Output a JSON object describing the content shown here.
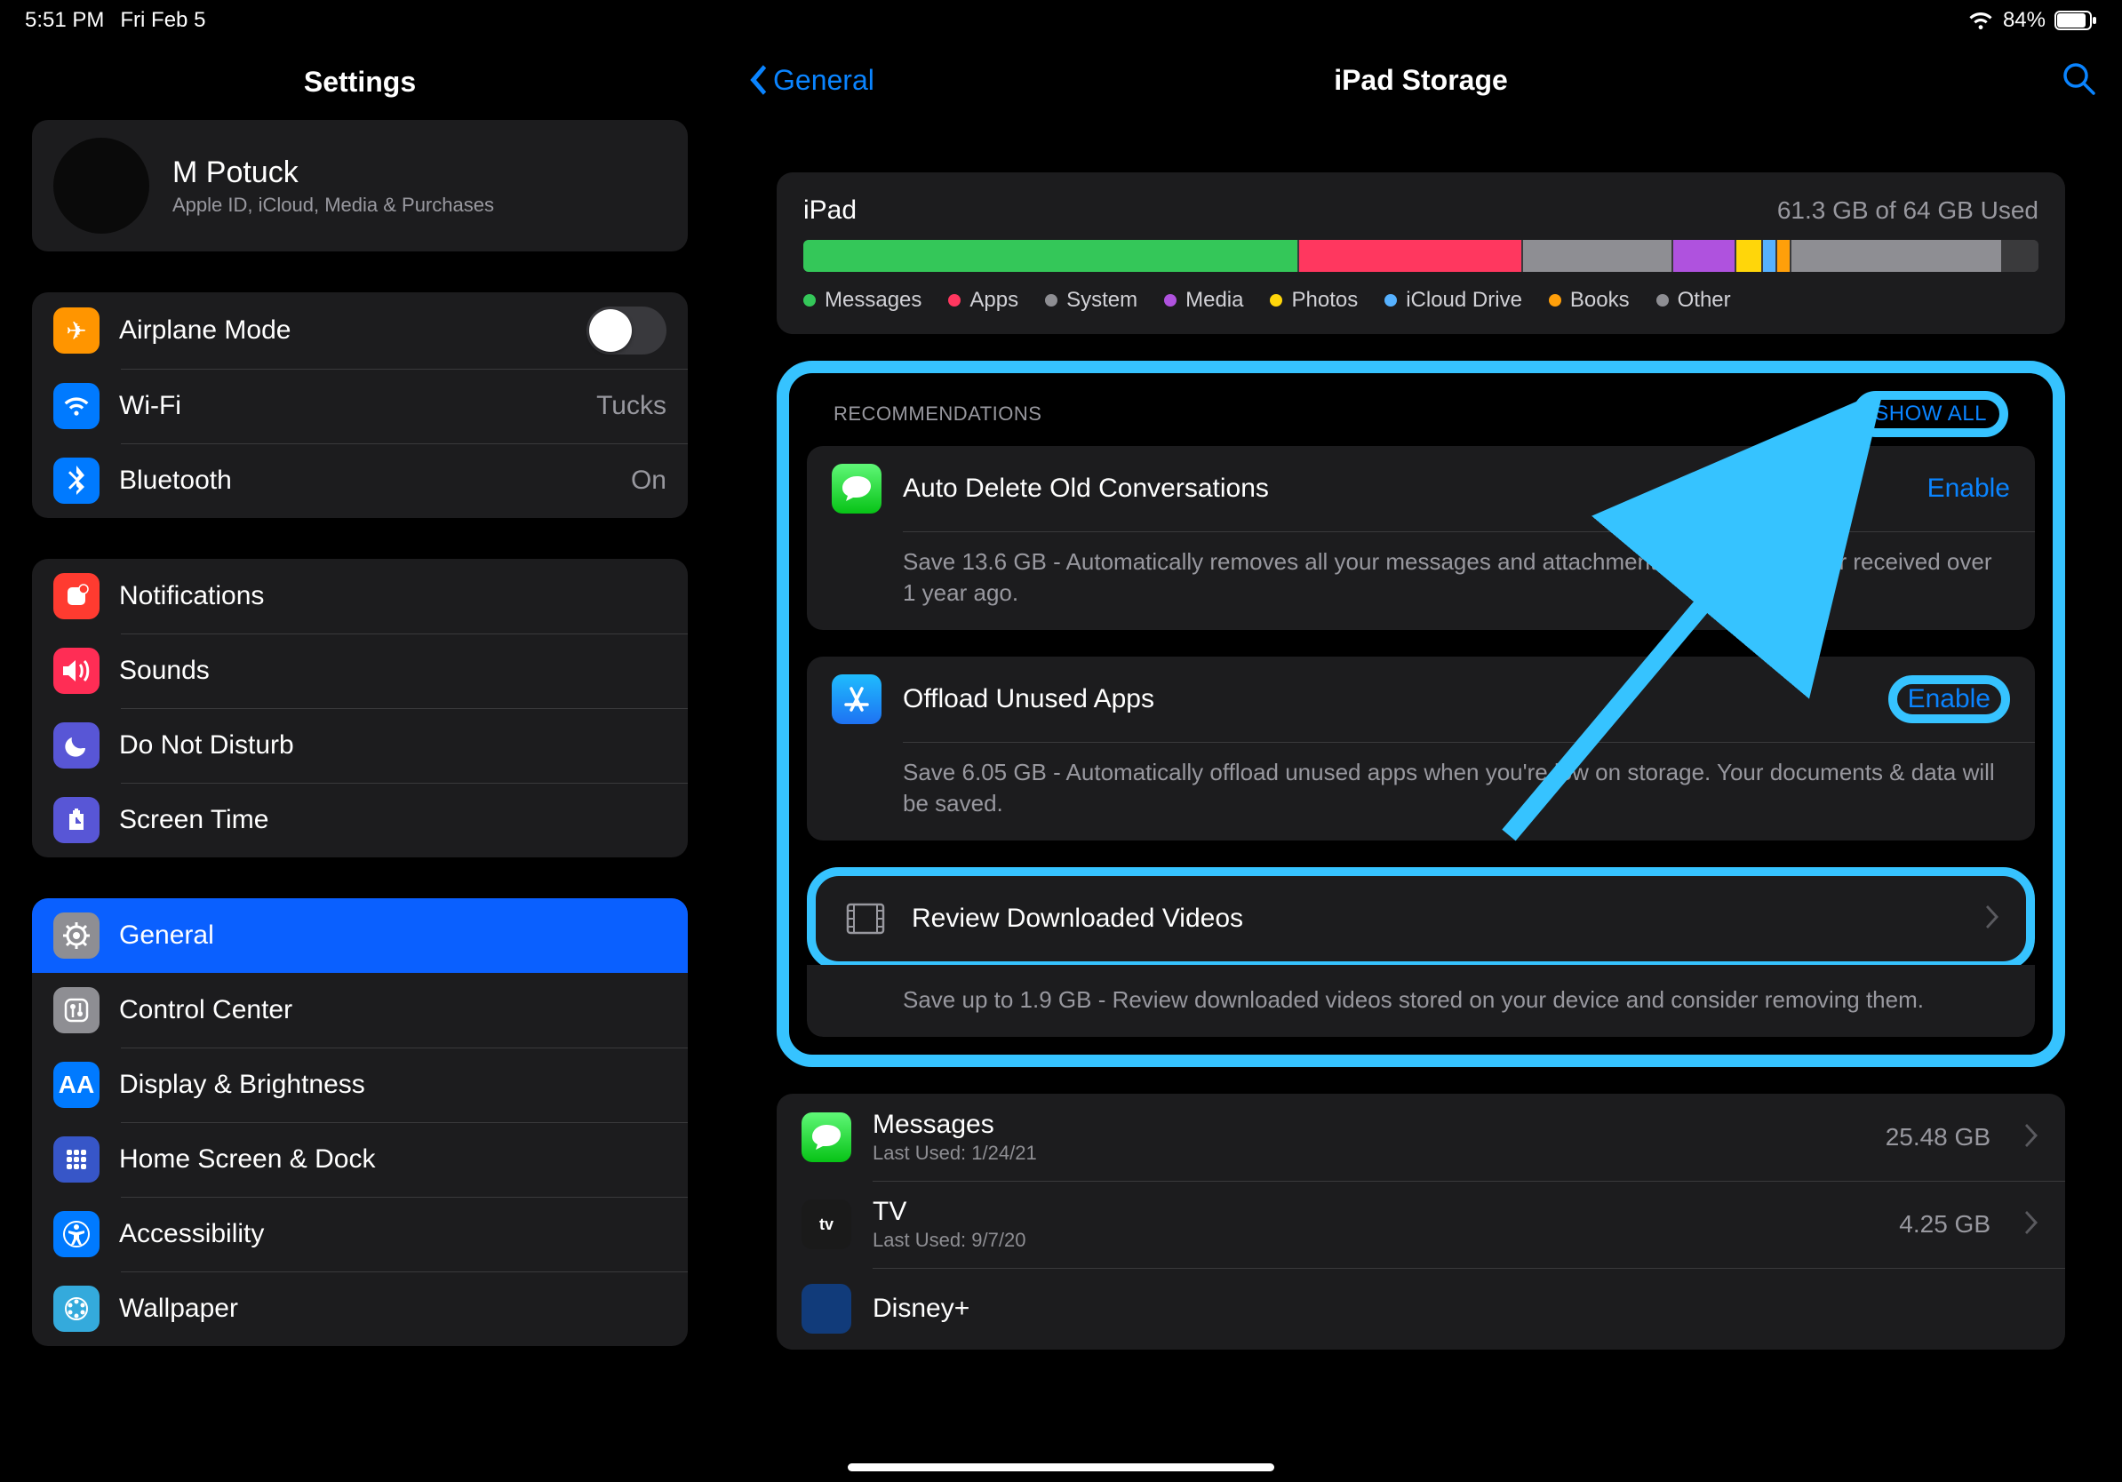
{
  "status": {
    "time": "5:51 PM",
    "date": "Fri Feb 5",
    "battery": "84%"
  },
  "sidebar": {
    "title": "Settings",
    "profile": {
      "name": "M Potuck",
      "sub": "Apple ID, iCloud, Media & Purchases"
    },
    "group1": {
      "airplane": "Airplane Mode",
      "wifi": "Wi-Fi",
      "wifi_value": "Tucks",
      "bluetooth": "Bluetooth",
      "bluetooth_value": "On"
    },
    "group2": {
      "notifications": "Notifications",
      "sounds": "Sounds",
      "dnd": "Do Not Disturb",
      "screentime": "Screen Time"
    },
    "group3": {
      "general": "General",
      "controlcenter": "Control Center",
      "display": "Display & Brightness",
      "homescreen": "Home Screen & Dock",
      "accessibility": "Accessibility",
      "wallpaper": "Wallpaper"
    }
  },
  "detail": {
    "back": "General",
    "title": "iPad Storage",
    "storage": {
      "device": "iPad",
      "used": "61.3 GB of 64 GB Used",
      "segments": [
        {
          "color": "#34c759",
          "pct": 40
        },
        {
          "color": "#ff375f",
          "pct": 18
        },
        {
          "color": "#8e8e93",
          "pct": 12
        },
        {
          "color": "#af52de",
          "pct": 5
        },
        {
          "color": "#ffd60a",
          "pct": 2
        },
        {
          "color": "#56b1ff",
          "pct": 1
        },
        {
          "color": "#ff9f0a",
          "pct": 1
        },
        {
          "color": "#8e8e93",
          "pct": 17
        }
      ],
      "legend": [
        {
          "color": "#34c759",
          "label": "Messages"
        },
        {
          "color": "#ff375f",
          "label": "Apps"
        },
        {
          "color": "#8e8e93",
          "label": "System"
        },
        {
          "color": "#af52de",
          "label": "Media"
        },
        {
          "color": "#ffd60a",
          "label": "Photos"
        },
        {
          "color": "#56b1ff",
          "label": "iCloud Drive"
        },
        {
          "color": "#ff9f0a",
          "label": "Books"
        },
        {
          "color": "#8e8e93",
          "label": "Other"
        }
      ]
    },
    "recommendations": {
      "header": "RECOMMENDATIONS",
      "show_all": "SHOW ALL",
      "items": [
        {
          "title": "Auto Delete Old Conversations",
          "action": "Enable",
          "desc": "Save 13.6 GB - Automatically removes all your messages and attachments that were sent or received over 1 year ago."
        },
        {
          "title": "Offload Unused Apps",
          "action": "Enable",
          "desc": "Save 6.05 GB - Automatically offload unused apps when you're low on storage. Your documents & data will be saved."
        },
        {
          "title": "Review Downloaded Videos",
          "desc": "Save up to 1.9 GB - Review downloaded videos stored on your device and consider removing them."
        }
      ]
    },
    "apps": [
      {
        "name": "Messages",
        "sub": "Last Used: 1/24/21",
        "size": "25.48 GB"
      },
      {
        "name": "TV",
        "sub": "Last Used: 9/7/20",
        "size": "4.25 GB"
      },
      {
        "name": "Disney+",
        "sub": "",
        "size": ""
      }
    ]
  }
}
